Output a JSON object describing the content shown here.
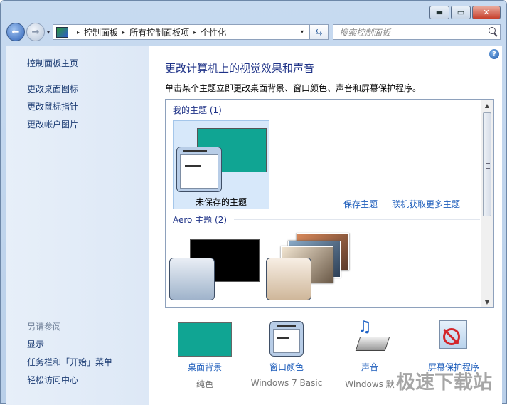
{
  "window": {
    "minimize_glyph": "▬",
    "maximize_glyph": "▭",
    "close_glyph": "✕"
  },
  "navigation": {
    "back_glyph": "←",
    "forward_glyph": "→",
    "dropdown_glyph": "▾"
  },
  "address_bar": {
    "crumbs": [
      "控制面板",
      "所有控制面板项",
      "个性化"
    ],
    "separator": "▸"
  },
  "search": {
    "placeholder": "搜索控制面板"
  },
  "sidebar": {
    "home": "控制面板主页",
    "links": [
      "更改桌面图标",
      "更改鼠标指针",
      "更改帐户图片"
    ],
    "see_also_title": "另请参阅",
    "see_also": [
      "显示",
      "任务栏和「开始」菜单",
      "轻松访问中心"
    ]
  },
  "main": {
    "help_glyph": "?",
    "heading": "更改计算机上的视觉效果和声音",
    "subheading": "单击某个主题立即更改桌面背景、窗口颜色、声音和屏幕保护程序。",
    "my_themes_group": "我的主题 (1)",
    "unsaved_theme": "未保存的主题",
    "save_theme": "保存主题",
    "get_more_themes": "联机获取更多主题",
    "aero_group": "Aero 主题 (2)",
    "theme_bg_color": "#10a593"
  },
  "bottom": {
    "items": [
      {
        "label": "桌面背景",
        "sub": "纯色"
      },
      {
        "label": "窗口颜色",
        "sub": "Windows 7 Basic"
      },
      {
        "label": "声音",
        "sub": "Windows 默"
      },
      {
        "label": "屏幕保护程序",
        "sub": ""
      }
    ]
  },
  "watermark": "极速下载站"
}
